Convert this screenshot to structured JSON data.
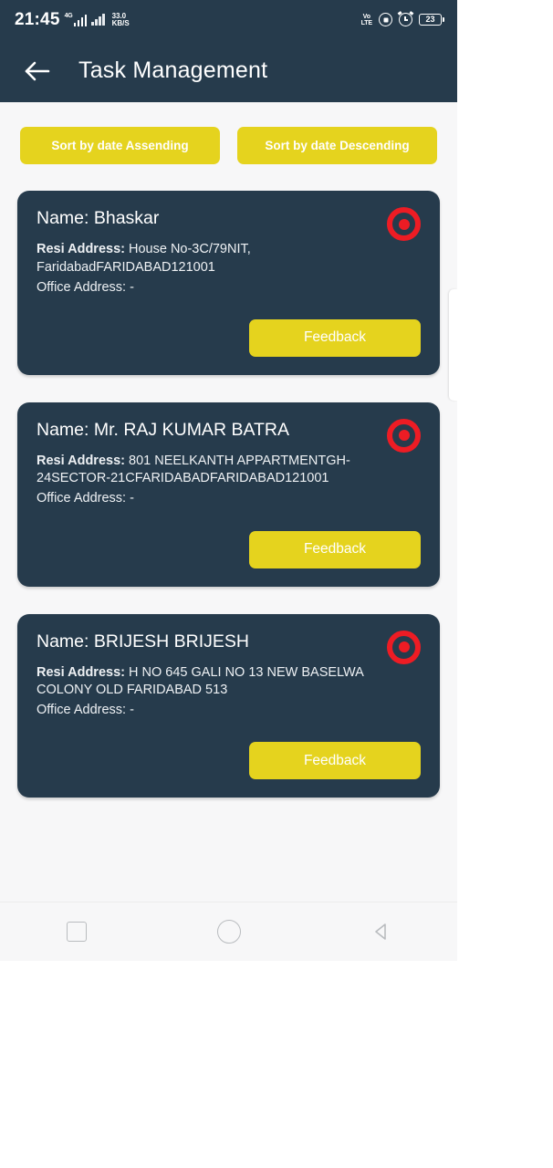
{
  "statusbar": {
    "time": "21:45",
    "network_type": "4G",
    "data_speed_value": "33.0",
    "data_speed_unit": "KB/S",
    "volte_line1": "Vo",
    "volte_line2": "LTE",
    "lock_icon": "lock-icon",
    "alarm_icon": "alarm-icon",
    "battery_percent": "23"
  },
  "appbar": {
    "back_icon": "back-arrow-icon",
    "title": "Task Management"
  },
  "sort": {
    "ascending_label": "Sort by date Assending",
    "descending_label": "Sort by date Descending"
  },
  "labels": {
    "name_prefix": "Name: ",
    "resi_label": "Resi Address: ",
    "office_label": "Office Address: ",
    "office_value": "-",
    "feedback_label": "Feedback",
    "status_icon": "record-target-icon"
  },
  "tasks": [
    {
      "name": "Name: Bhaskar",
      "resi_label": "Resi Address: ",
      "resi_value": "House No-3C/79NIT, FaridabadFARIDABAD121001",
      "office": "Office Address: -",
      "feedback_label": "Feedback"
    },
    {
      "name": "Name: Mr. RAJ KUMAR BATRA",
      "resi_label": "Resi Address: ",
      "resi_value": "801 NEELKANTH APPARTMENTGH-24SECTOR-21CFARIDABADFARIDABAD121001",
      "office": "Office Address: -",
      "feedback_label": "Feedback"
    },
    {
      "name": "Name: BRIJESH BRIJESH",
      "resi_label": "Resi Address: ",
      "resi_value": "H NO 645 GALI NO 13 NEW BASELWA COLONY OLD FARIDABAD 513",
      "office": "Office Address: -",
      "feedback_label": "Feedback"
    }
  ],
  "navbar": {
    "recents_icon": "square-recents-icon",
    "home_icon": "circle-home-icon",
    "back_icon": "triangle-back-icon"
  },
  "colors": {
    "primary_dark": "#263B4C",
    "accent_yellow": "#E5D31E",
    "status_red": "#ED1C24",
    "page_bg": "#F7F7F8"
  }
}
